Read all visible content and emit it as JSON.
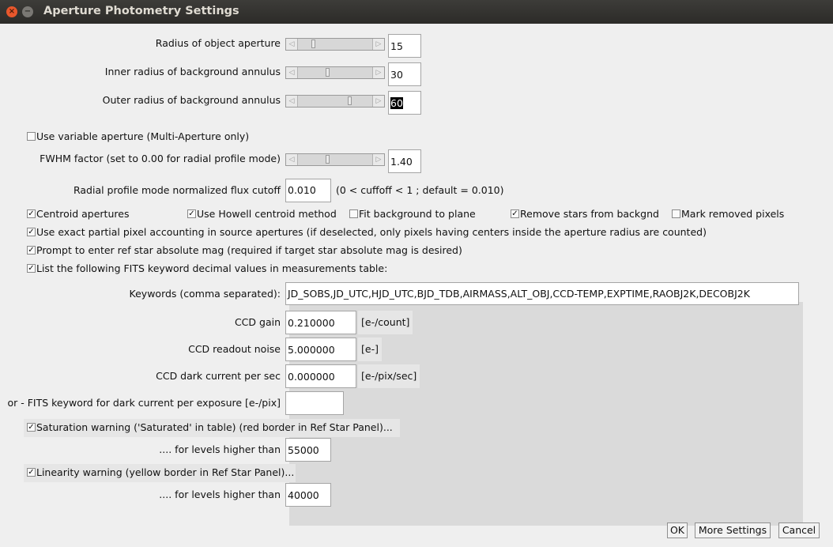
{
  "window": {
    "title": "Aperture Photometry Settings",
    "close_glyph": "×",
    "min_glyph": "−"
  },
  "apertures": {
    "object_radius": {
      "label": "Radius of object aperture",
      "value": "15",
      "slider_fraction": 0.2
    },
    "inner_radius": {
      "label": "Inner radius of background annulus",
      "value": "30",
      "slider_fraction": 0.4
    },
    "outer_radius": {
      "label": "Outer radius of background annulus",
      "value": "60",
      "slider_fraction": 0.7
    }
  },
  "variable_aperture": {
    "label": "Use variable aperture (Multi-Aperture only)",
    "checked": false
  },
  "fwhm": {
    "label": "FWHM factor (set to 0.00 for radial profile mode)",
    "value": "1.40",
    "slider_fraction": 0.4
  },
  "radial_cutoff": {
    "label": "Radial profile mode normalized flux cutoff",
    "value": "0.010",
    "hint": "(0 < cuffoff < 1 ; default = 0.010)"
  },
  "options_row": [
    {
      "label": "Centroid apertures",
      "checked": true
    },
    {
      "label": "Use Howell centroid method",
      "checked": true
    },
    {
      "label": "Fit background to plane",
      "checked": false
    },
    {
      "label": "Remove stars from backgnd",
      "checked": true
    },
    {
      "label": "Mark removed pixels",
      "checked": false
    }
  ],
  "exact_partial": {
    "label": "Use exact partial pixel accounting in source apertures (if deselected, only pixels having centers inside the aperture radius are counted)",
    "checked": true
  },
  "prompt_ref": {
    "label": "Prompt to enter ref star absolute mag (required if target star absolute mag is desired)",
    "checked": true
  },
  "list_keywords": {
    "label": "List the following FITS keyword decimal values in measurements table:",
    "checked": true
  },
  "keywords": {
    "label": "Keywords (comma separated):",
    "value": "JD_SOBS,JD_UTC,HJD_UTC,BJD_TDB,AIRMASS,ALT_OBJ,CCD-TEMP,EXPTIME,RAOBJ2K,DECOBJ2K"
  },
  "ccd": {
    "gain": {
      "label": "CCD gain",
      "value": "0.210000",
      "unit": "[e-/count]"
    },
    "readout": {
      "label": "CCD readout noise",
      "value": "5.000000",
      "unit": "[e-]"
    },
    "dark": {
      "label": "CCD dark current per sec",
      "value": "0.000000",
      "unit": "[e-/pix/sec]"
    },
    "dark_keyword": {
      "label": "or - FITS keyword for dark current per exposure [e-/pix]",
      "value": ""
    }
  },
  "saturation": {
    "label": "Saturation warning ('Saturated' in table) (red border in Ref Star Panel)...",
    "checked": true,
    "levels_label": ".... for levels higher than",
    "value": "55000"
  },
  "linearity": {
    "label": "Linearity warning (yellow border in Ref Star Panel)...",
    "checked": true,
    "levels_label": ".... for levels higher than",
    "value": "40000"
  },
  "buttons": {
    "ok": "OK",
    "more": "More Settings",
    "cancel": "Cancel"
  },
  "check_glyph": "✓"
}
